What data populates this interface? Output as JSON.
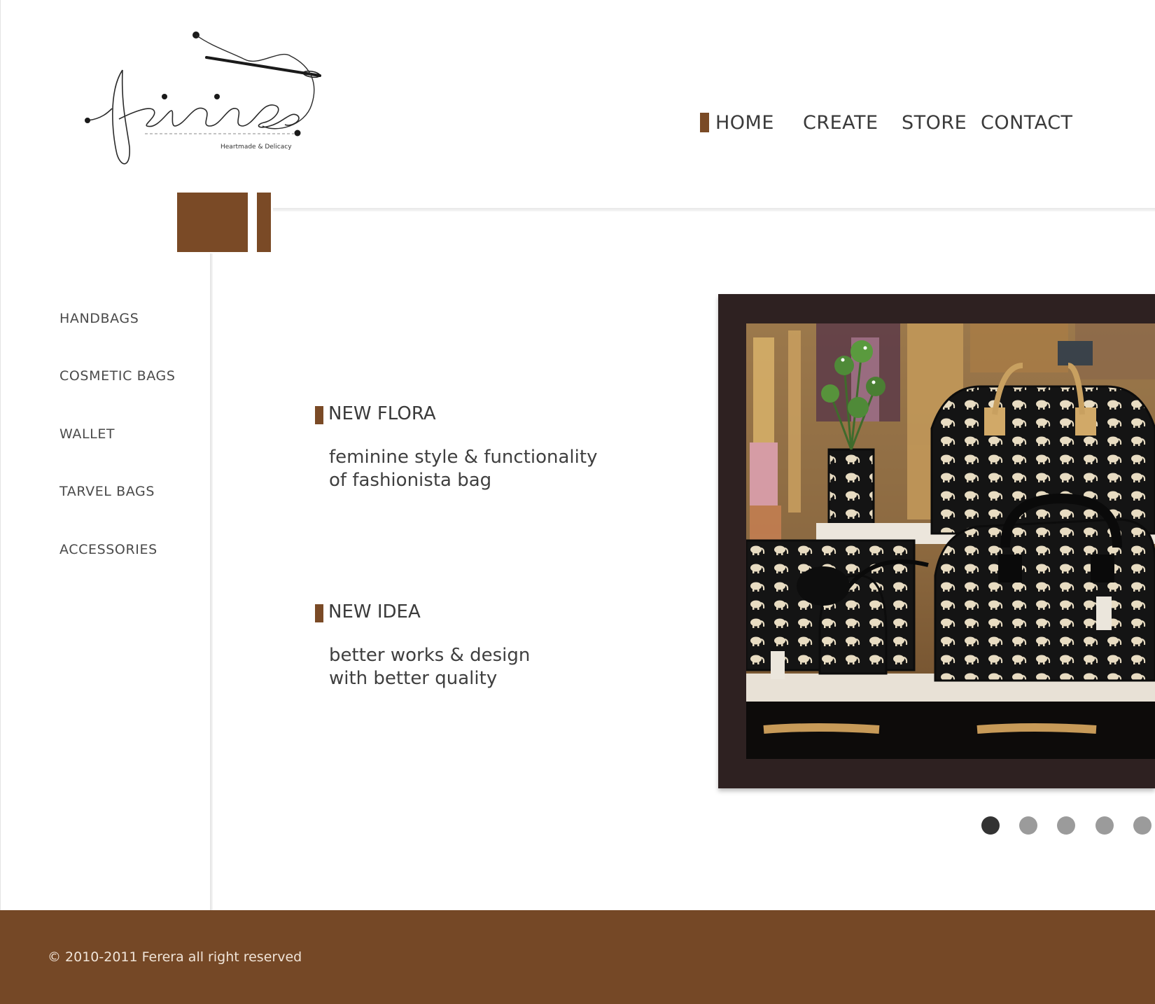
{
  "brand": {
    "name": "Ferera",
    "tagline": "Heartmade & Delicacy",
    "accent_color": "#7a4a26",
    "footer_color": "#754826",
    "frame_color": "#2e2121"
  },
  "nav": {
    "items": [
      {
        "label": "HOME",
        "active": true
      },
      {
        "label": "CREATE",
        "active": false
      },
      {
        "label": "STORE",
        "active": false
      },
      {
        "label": "CONTACT",
        "active": false
      }
    ]
  },
  "sidebar": {
    "items": [
      {
        "label": "HANDBAGS"
      },
      {
        "label": "COSMETIC BAGS"
      },
      {
        "label": "WALLET"
      },
      {
        "label": "TARVEL BAGS"
      },
      {
        "label": "ACCESSORIES"
      }
    ]
  },
  "promos": [
    {
      "title": "NEW FLORA",
      "lines": [
        "feminine style & functionality",
        "of fashionista bag"
      ]
    },
    {
      "title": "NEW IDEA",
      "lines": [
        "better works & design",
        "with better quality"
      ]
    }
  ],
  "slider": {
    "image": "product-photo",
    "dots": [
      {
        "active": true
      },
      {
        "active": false
      },
      {
        "active": false
      },
      {
        "active": false
      },
      {
        "active": false
      }
    ]
  },
  "footer": {
    "copyright": "© 2010-2011 Ferera all right reserved"
  }
}
